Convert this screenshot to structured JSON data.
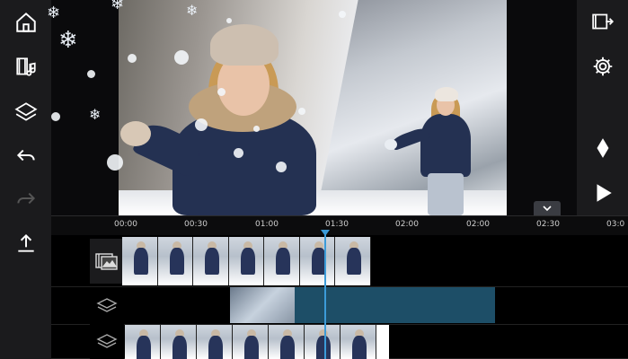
{
  "left_toolbar": [
    "home-icon",
    "media-icon",
    "layers-icon",
    "undo-icon",
    "redo-icon",
    "export-icon"
  ],
  "right_toolbar": [
    "export-frame-icon",
    "settings-icon",
    "keyframe-icon",
    "play-icon"
  ],
  "timeline": {
    "ticks": [
      "00:00",
      "00:30",
      "01:00",
      "01:30",
      "02:00",
      "02:00",
      "02:30",
      "03:0"
    ]
  },
  "tracks": [
    "media-track-icon",
    "layer-track-icon",
    "layer-track-icon"
  ],
  "colors": {
    "accent": "#3c9bd8",
    "panel": "#1b1b1d",
    "teal_clip": "#1d4e67"
  }
}
